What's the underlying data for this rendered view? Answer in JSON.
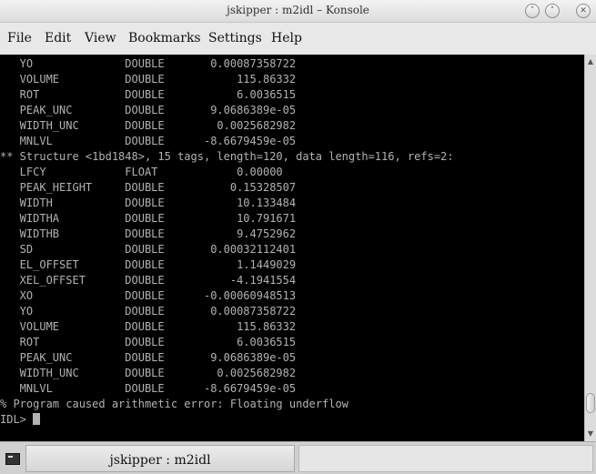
{
  "window": {
    "title": "jskipper : m2idl – Konsole",
    "buttons": [
      {
        "name": "minimize",
        "glyph": "˅"
      },
      {
        "name": "maximize",
        "glyph": "˄"
      },
      {
        "name": "close",
        "glyph": "✕"
      }
    ]
  },
  "menu": {
    "items": [
      "File",
      "Edit",
      "View",
      "Bookmarks",
      "Settings",
      "Help"
    ]
  },
  "terminal": {
    "lines": [
      "   YO              DOUBLE       0.00087358722",
      "   VOLUME          DOUBLE           115.86332",
      "   ROT             DOUBLE           6.0036515",
      "   PEAK_UNC        DOUBLE       9.0686389e-05",
      "   WIDTH_UNC       DOUBLE        0.0025682982",
      "   MNLVL           DOUBLE      -8.6679459e-05",
      "** Structure <1bd1848>, 15 tags, length=120, data length=116, refs=2:",
      "   LFCY            FLOAT            0.00000",
      "   PEAK_HEIGHT     DOUBLE          0.15328507",
      "   WIDTH           DOUBLE           10.133484",
      "   WIDTHA          DOUBLE           10.791671",
      "   WIDTHB          DOUBLE           9.4752962",
      "   SD              DOUBLE       0.00032112401",
      "   EL_OFFSET       DOUBLE           1.1449029",
      "   XEL_OFFSET      DOUBLE          -4.1941554",
      "   XO              DOUBLE      -0.00060948513",
      "   YO              DOUBLE       0.00087358722",
      "   VOLUME          DOUBLE           115.86332",
      "   ROT             DOUBLE           6.0036515",
      "   PEAK_UNC        DOUBLE       9.0686389e-05",
      "   WIDTH_UNC       DOUBLE        0.0025682982",
      "   MNLVL           DOUBLE      -8.6679459e-05",
      "% Program caused arithmetic error: Floating underflow"
    ],
    "prompt": "IDL> "
  },
  "scrollbar": {
    "up_glyph": "▲",
    "down_glyph": "▼"
  },
  "taskbar": {
    "task_label": "jskipper : m2idl",
    "icon": "terminal-icon"
  }
}
